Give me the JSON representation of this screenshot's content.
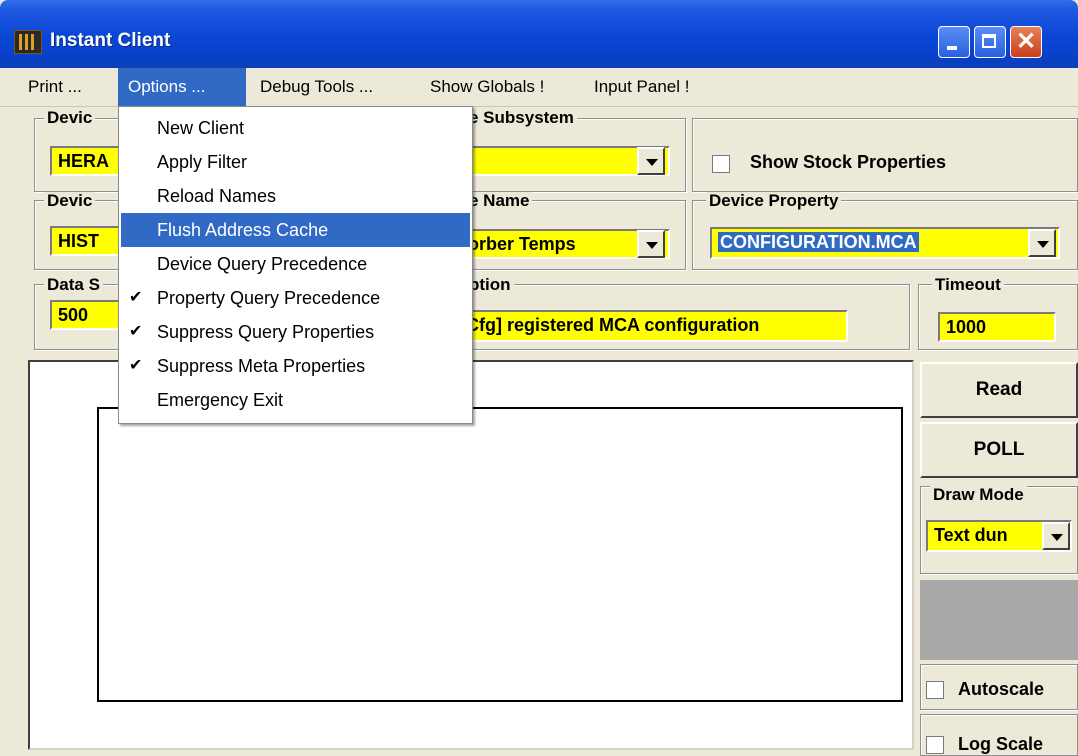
{
  "window": {
    "title": "Instant Client"
  },
  "menubar": [
    "Print ...",
    "Options ...",
    "Debug Tools ...",
    "Show Globals !",
    "Input Panel !"
  ],
  "options_menu": [
    {
      "label": "New Client",
      "checked": false
    },
    {
      "label": "Apply Filter",
      "checked": false
    },
    {
      "label": "Reload Names",
      "checked": false
    },
    {
      "label": "Flush Address Cache",
      "checked": false,
      "highlighted": true
    },
    {
      "label": "Device Query Precedence",
      "checked": false
    },
    {
      "label": "Property Query Precedence",
      "checked": true
    },
    {
      "label": "Suppress Query Properties",
      "checked": true
    },
    {
      "label": "Suppress Meta Properties",
      "checked": true
    },
    {
      "label": "Emergency Exit",
      "checked": false
    }
  ],
  "check_glyph": "✔",
  "row1": {
    "device_label_visible": "Devic",
    "device_value_visible": "HERA",
    "subsystem_label_visible": "e Subsystem",
    "show_stock_label": "Show Stock Properties"
  },
  "row2": {
    "device_label_visible": "Devic",
    "device_value_visible": "HIST",
    "name_label_visible": "e Name",
    "name_value_visible": "orber Temps",
    "property_label": "Device Property",
    "property_value": "CONFIGURATION.MCA"
  },
  "row3": {
    "data_label_visible": "Data S",
    "data_value": "500",
    "description_label_visible": "ption",
    "description_value_visible": "Cfg] registered MCA configuration",
    "timeout_label": "Timeout",
    "timeout_value": "1000"
  },
  "side": {
    "read": "Read",
    "poll": "POLL",
    "draw_mode_label": "Draw Mode",
    "draw_mode_value": "Text dun",
    "autoscale": "Autoscale",
    "log_scale": "Log Scale"
  },
  "colors": {
    "field_yellow": "#ffff00",
    "highlight": "#316ac5",
    "titlebar": "#0a46d6"
  }
}
